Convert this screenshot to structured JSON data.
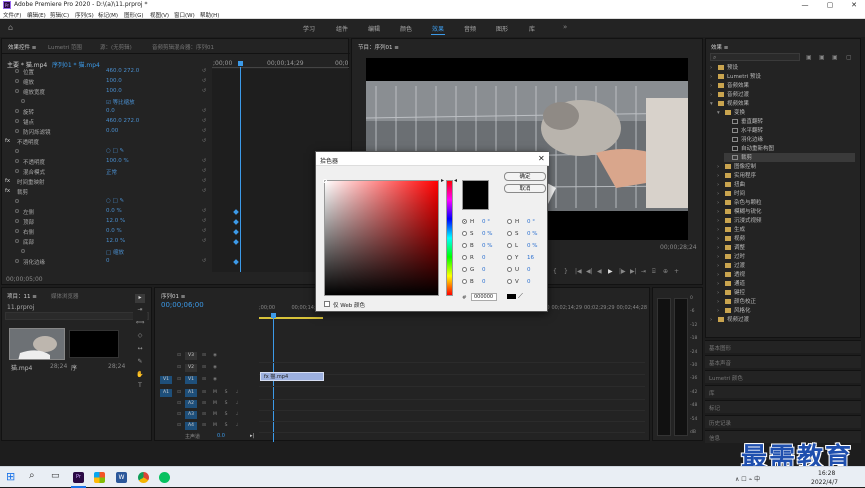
{
  "window": {
    "app_icon_text": "Pr",
    "title": "Adobe Premiere Pro 2020 - D:\\(a)\\11.prproj *",
    "min": "—",
    "max": "▢",
    "close": "✕"
  },
  "menu": [
    "文件(F)",
    "编辑(E)",
    "剪辑(C)",
    "序列(S)",
    "标记(M)",
    "图形(G)",
    "视图(V)",
    "窗口(W)",
    "帮助(H)"
  ],
  "workspaces": [
    "学习",
    "组件",
    "编辑",
    "颜色",
    "效果",
    "音频",
    "图形",
    "库"
  ],
  "workspace_active": "效果",
  "effect_controls": {
    "tabs": [
      "效果控件 ≡",
      "Lumetri 范围",
      "源：(无剪辑)",
      "音频剪辑混合器：序列01"
    ],
    "tab_active": "效果控件 ≡",
    "master_clip": "主要 * 猫.mp4",
    "seq_clip": "序列01 * 猫.mp4",
    "ruler": {
      "start": ";00;00",
      "mid": "00;00;14;29",
      "end": "00;0"
    },
    "rows": [
      {
        "label": "位置",
        "val": "460.0    272.0",
        "indent": 2
      },
      {
        "label": "缩放",
        "val": "100.0",
        "indent": 2
      },
      {
        "label": "缩放宽度",
        "val": "100.0",
        "indent": 2
      },
      {
        "label": "",
        "val": "☑ 等比缩放",
        "indent": 3
      },
      {
        "label": "旋转",
        "val": "0.0",
        "indent": 2
      },
      {
        "label": "锚点",
        "val": "460.0    272.0",
        "indent": 2
      },
      {
        "label": "防闪烁滤镜",
        "val": "0.00",
        "indent": 2
      },
      {
        "label": "不透明度",
        "val": "",
        "indent": 1
      },
      {
        "label": "",
        "val": "○ □ ✎",
        "indent": 2
      },
      {
        "label": "不透明度",
        "val": "100.0 %",
        "indent": 2
      },
      {
        "label": "混合模式",
        "val": "正常",
        "indent": 2
      },
      {
        "label": "时间重映射",
        "val": "",
        "indent": 1
      },
      {
        "label": "裁剪",
        "val": "",
        "indent": 1
      },
      {
        "label": "",
        "val": "○ □ ✎",
        "indent": 2
      },
      {
        "label": "左侧",
        "val": "0.0 %",
        "indent": 2
      },
      {
        "label": "顶部",
        "val": "12.0 %",
        "indent": 2
      },
      {
        "label": "右侧",
        "val": "0.0 %",
        "indent": 2
      },
      {
        "label": "底部",
        "val": "12.0 %",
        "indent": 2
      },
      {
        "label": "",
        "val": "□ 缩放",
        "indent": 3
      },
      {
        "label": "羽化边缘",
        "val": "0",
        "indent": 2
      }
    ],
    "timecode": "00;00;05;00"
  },
  "program": {
    "tab": "节目：序列01 ≡",
    "timecode_right": "00;00;28;24",
    "buttons": [
      "▾",
      "{",
      "}",
      "|◀",
      "◀|",
      "◀",
      "▶",
      "|▶",
      "▶|",
      "⇥",
      "⌸",
      "⊕",
      "+"
    ]
  },
  "project": {
    "tabs": [
      "项目：11 ≡",
      "媒体浏览器"
    ],
    "file": "11.prproj",
    "items": [
      {
        "name": "猫.mp4",
        "dur": "28;24"
      },
      {
        "name": "序",
        "dur": "28;24"
      }
    ]
  },
  "timeline": {
    "tab": "序列01 ≡",
    "timecode": "00;00;06;00",
    "ruler": [
      ";00;00",
      "00;00;14;29",
      "00;00;29;29",
      "00;00;44;28",
      "00;01;00;00",
      "00;01;14;29",
      "00;01;29;29",
      "00;01;44;28",
      "00;02;00;00",
      "00;02;14;29",
      "00;02;29;29",
      "00;02;44;28"
    ],
    "video_tracks": [
      "V3",
      "V2",
      "V1"
    ],
    "audio_tracks": [
      "A1",
      "A2",
      "A3",
      "A4"
    ],
    "src_v": "V1",
    "src_a": "A1",
    "mix_label": "主声道",
    "mix_val": "0.0",
    "clip_label": "fx 猫.mp4",
    "meter_db": [
      "0",
      "-6",
      "-12",
      "-18",
      "-24",
      "-30",
      "-36",
      "-42",
      "-48",
      "-54",
      "dB"
    ]
  },
  "effects": {
    "title": "效果 ≡",
    "items": [
      {
        "label": "预设",
        "type": "folder",
        "level": 0,
        "open": false
      },
      {
        "label": "Lumetri 预设",
        "type": "folder",
        "level": 0,
        "open": false
      },
      {
        "label": "音频效果",
        "type": "folder",
        "level": 0,
        "open": false
      },
      {
        "label": "音频过渡",
        "type": "folder",
        "level": 0,
        "open": false
      },
      {
        "label": "视频效果",
        "type": "folder",
        "level": 0,
        "open": true
      },
      {
        "label": "变换",
        "type": "folder",
        "level": 1,
        "open": true
      },
      {
        "label": "垂直翻转",
        "type": "fx",
        "level": 2
      },
      {
        "label": "水平翻转",
        "type": "fx",
        "level": 2
      },
      {
        "label": "羽化边缘",
        "type": "fx",
        "level": 2
      },
      {
        "label": "自动重新构图",
        "type": "fx",
        "level": 2
      },
      {
        "label": "裁剪",
        "type": "fx",
        "level": 2,
        "selected": true
      },
      {
        "label": "图像控制",
        "type": "folder",
        "level": 1,
        "open": false
      },
      {
        "label": "实用程序",
        "type": "folder",
        "level": 1,
        "open": false
      },
      {
        "label": "扭曲",
        "type": "folder",
        "level": 1,
        "open": false
      },
      {
        "label": "时间",
        "type": "folder",
        "level": 1,
        "open": false
      },
      {
        "label": "杂色与颗粒",
        "type": "folder",
        "level": 1,
        "open": false
      },
      {
        "label": "模糊与锐化",
        "type": "folder",
        "level": 1,
        "open": false
      },
      {
        "label": "沉浸式视频",
        "type": "folder",
        "level": 1,
        "open": false
      },
      {
        "label": "生成",
        "type": "folder",
        "level": 1,
        "open": false
      },
      {
        "label": "视频",
        "type": "folder",
        "level": 1,
        "open": false
      },
      {
        "label": "调整",
        "type": "folder",
        "level": 1,
        "open": false
      },
      {
        "label": "过时",
        "type": "folder",
        "level": 1,
        "open": false
      },
      {
        "label": "过渡",
        "type": "folder",
        "level": 1,
        "open": false
      },
      {
        "label": "透视",
        "type": "folder",
        "level": 1,
        "open": false
      },
      {
        "label": "通道",
        "type": "folder",
        "level": 1,
        "open": false
      },
      {
        "label": "键控",
        "type": "folder",
        "level": 1,
        "open": false
      },
      {
        "label": "颜色校正",
        "type": "folder",
        "level": 1,
        "open": false
      },
      {
        "label": "风格化",
        "type": "folder",
        "level": 1,
        "open": false
      },
      {
        "label": "视频过渡",
        "type": "folder",
        "level": 0,
        "open": false
      }
    ],
    "side_panels": [
      "基本图形",
      "基本声音",
      "Lumetri 颜色",
      "库",
      "标记",
      "历史记录",
      "信息"
    ]
  },
  "color_picker": {
    "title": "拾色器",
    "ok": "确定",
    "cancel": "取消",
    "web_only": "仅 Web 颜色",
    "hex_label": "#",
    "hex": "000000",
    "fields_left": [
      {
        "k": "H",
        "v": "0 °",
        "on": true
      },
      {
        "k": "S",
        "v": "0 %",
        "on": false
      },
      {
        "k": "B",
        "v": "0 %",
        "on": false
      },
      {
        "k": "R",
        "v": "0",
        "on": false
      },
      {
        "k": "G",
        "v": "0",
        "on": false
      },
      {
        "k": "B",
        "v": "0",
        "on": false
      }
    ],
    "fields_right": [
      {
        "k": "H",
        "v": "0 °"
      },
      {
        "k": "S",
        "v": "0 %"
      },
      {
        "k": "L",
        "v": "0 %"
      },
      {
        "k": "Y",
        "v": "16"
      },
      {
        "k": "U",
        "v": "0"
      },
      {
        "k": "V",
        "v": "0"
      }
    ]
  },
  "watermark": "最需教育",
  "taskbar": {
    "time": "16:28",
    "date": "2022/4/7",
    "tray": "∧  ☐  ⌁  中",
    "apps": [
      "Pr",
      "W",
      "●",
      "●",
      "●"
    ]
  }
}
